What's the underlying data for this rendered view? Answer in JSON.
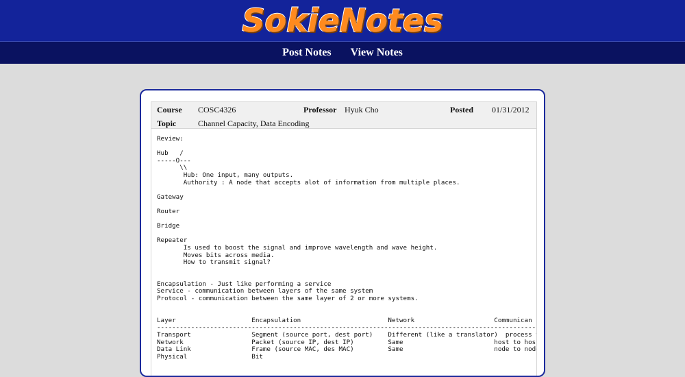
{
  "site": {
    "logo": "SokieNotes"
  },
  "nav": {
    "post_notes": "Post Notes",
    "view_notes": "View Notes"
  },
  "note": {
    "course_label": "Course",
    "course": "COSC4326",
    "professor_label": "Professor",
    "professor": "Hyuk Cho",
    "posted_label": "Posted",
    "posted": "01/31/2012",
    "topic_label": "Topic",
    "topic": "Channel Capacity, Data Encoding",
    "body": "Review:\n\nHub   /\n-----O---\n      \\\\\n       Hub: One input, many outputs.\n       Authority : A node that accepts alot of information from multiple places.\n\nGateway\n\nRouter\n\nBridge\n\nRepeater\n       Is used to boost the signal and improve wavelength and wave height.\n       Moves bits across media.\n       How to transmit signal?\n\n\nEncapsulation - Just like performing a service\nService - communication between layers of the same system\nProtocol - communication between the same layer of 2 or more systems.\n\n\nLayer                    Encapsulation                       Network                     Communican\n----------------------------------------------------------------------------------------------------\nTransport                Segment (source port, dest port)    Different (like a translator)  process to pro\nNetwork                  Packet (source IP, dest IP)         Same                        host to host\nData Link                Frame (source MAC, des MAC)         Same                        node to node -\nPhysical                 Bit"
  }
}
